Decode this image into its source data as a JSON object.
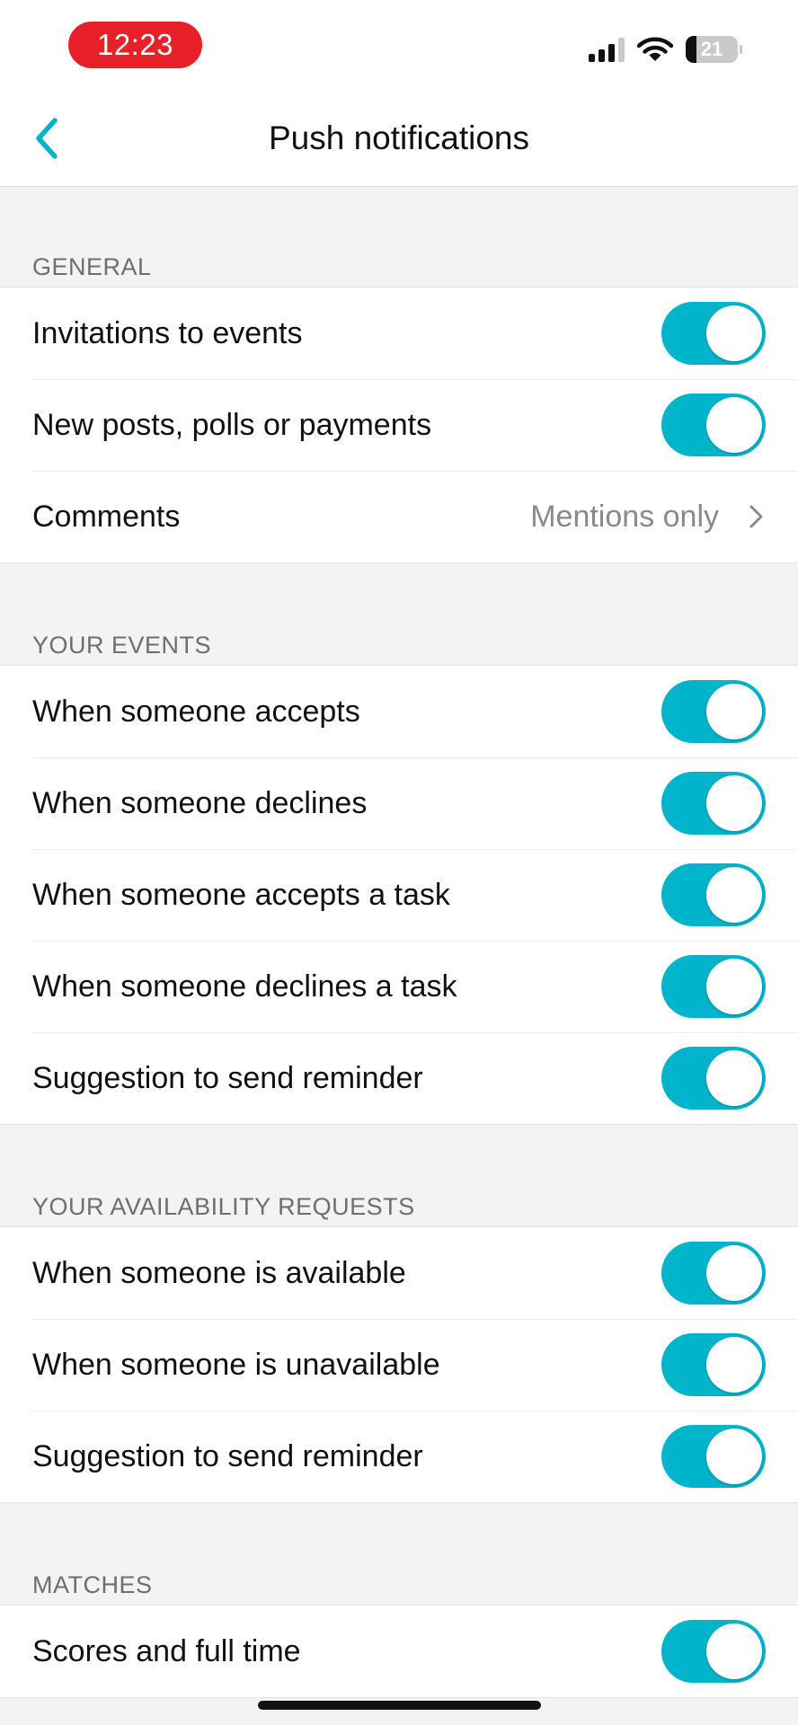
{
  "status_bar": {
    "time": "12:23",
    "battery_level": "21",
    "signal_bars_active": 3,
    "signal_bars_total": 4,
    "wifi_icon": "wifi-icon"
  },
  "nav": {
    "title": "Push notifications",
    "back_icon": "chevron-left-icon"
  },
  "colors": {
    "accent": "#00b4cc",
    "time_pill": "#e8202a",
    "background": "#f3f3f5"
  },
  "sections": {
    "general": {
      "header": "GENERAL",
      "items": [
        {
          "label": "Invitations to events",
          "enabled": true
        },
        {
          "label": "New posts, polls or payments",
          "enabled": true
        },
        {
          "label": "Comments",
          "value": "Mentions only"
        }
      ]
    },
    "your_events": {
      "header": "YOUR EVENTS",
      "items": [
        {
          "label": "When someone accepts",
          "enabled": true
        },
        {
          "label": "When someone declines",
          "enabled": true
        },
        {
          "label": "When someone accepts a task",
          "enabled": true
        },
        {
          "label": "When someone declines a task",
          "enabled": true
        },
        {
          "label": "Suggestion to send reminder",
          "enabled": true
        }
      ]
    },
    "availability": {
      "header": "YOUR AVAILABILITY REQUESTS",
      "items": [
        {
          "label": "When someone is available",
          "enabled": true
        },
        {
          "label": "When someone is unavailable",
          "enabled": true
        },
        {
          "label": "Suggestion to send reminder",
          "enabled": true
        }
      ]
    },
    "matches": {
      "header": "MATCHES",
      "items": [
        {
          "label": "Scores and full time",
          "enabled": true
        }
      ]
    }
  }
}
